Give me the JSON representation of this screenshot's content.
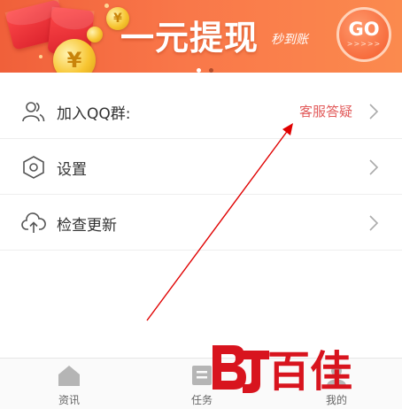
{
  "banner": {
    "title": "一元提现",
    "tag": "秒到账",
    "go_label": "GO",
    "go_arrows": ">>>>>",
    "coin_symbol": "¥",
    "pager_active": 1,
    "pager_count": 2
  },
  "menu": {
    "items": [
      {
        "label": "加入QQ群:",
        "extra": "客服答疑",
        "icon": "people-icon"
      },
      {
        "label": "设置",
        "extra": "",
        "icon": "gear-hexagon-icon"
      },
      {
        "label": "检查更新",
        "extra": "",
        "icon": "cloud-upload-icon"
      }
    ]
  },
  "bottom_nav": {
    "items": [
      {
        "label": "资讯",
        "icon": "home-icon"
      },
      {
        "label": "任务",
        "icon": "task-icon"
      },
      {
        "label": "我的",
        "icon": "profile-icon"
      }
    ]
  },
  "watermark": {
    "text": "百佳",
    "logo": "bj-logo"
  },
  "colors": {
    "banner_start": "#f0603a",
    "banner_end": "#fb8a4e",
    "accent_text": "#e25b5b",
    "annotation_arrow": "#e00000",
    "watermark_red": "#d8141e"
  }
}
